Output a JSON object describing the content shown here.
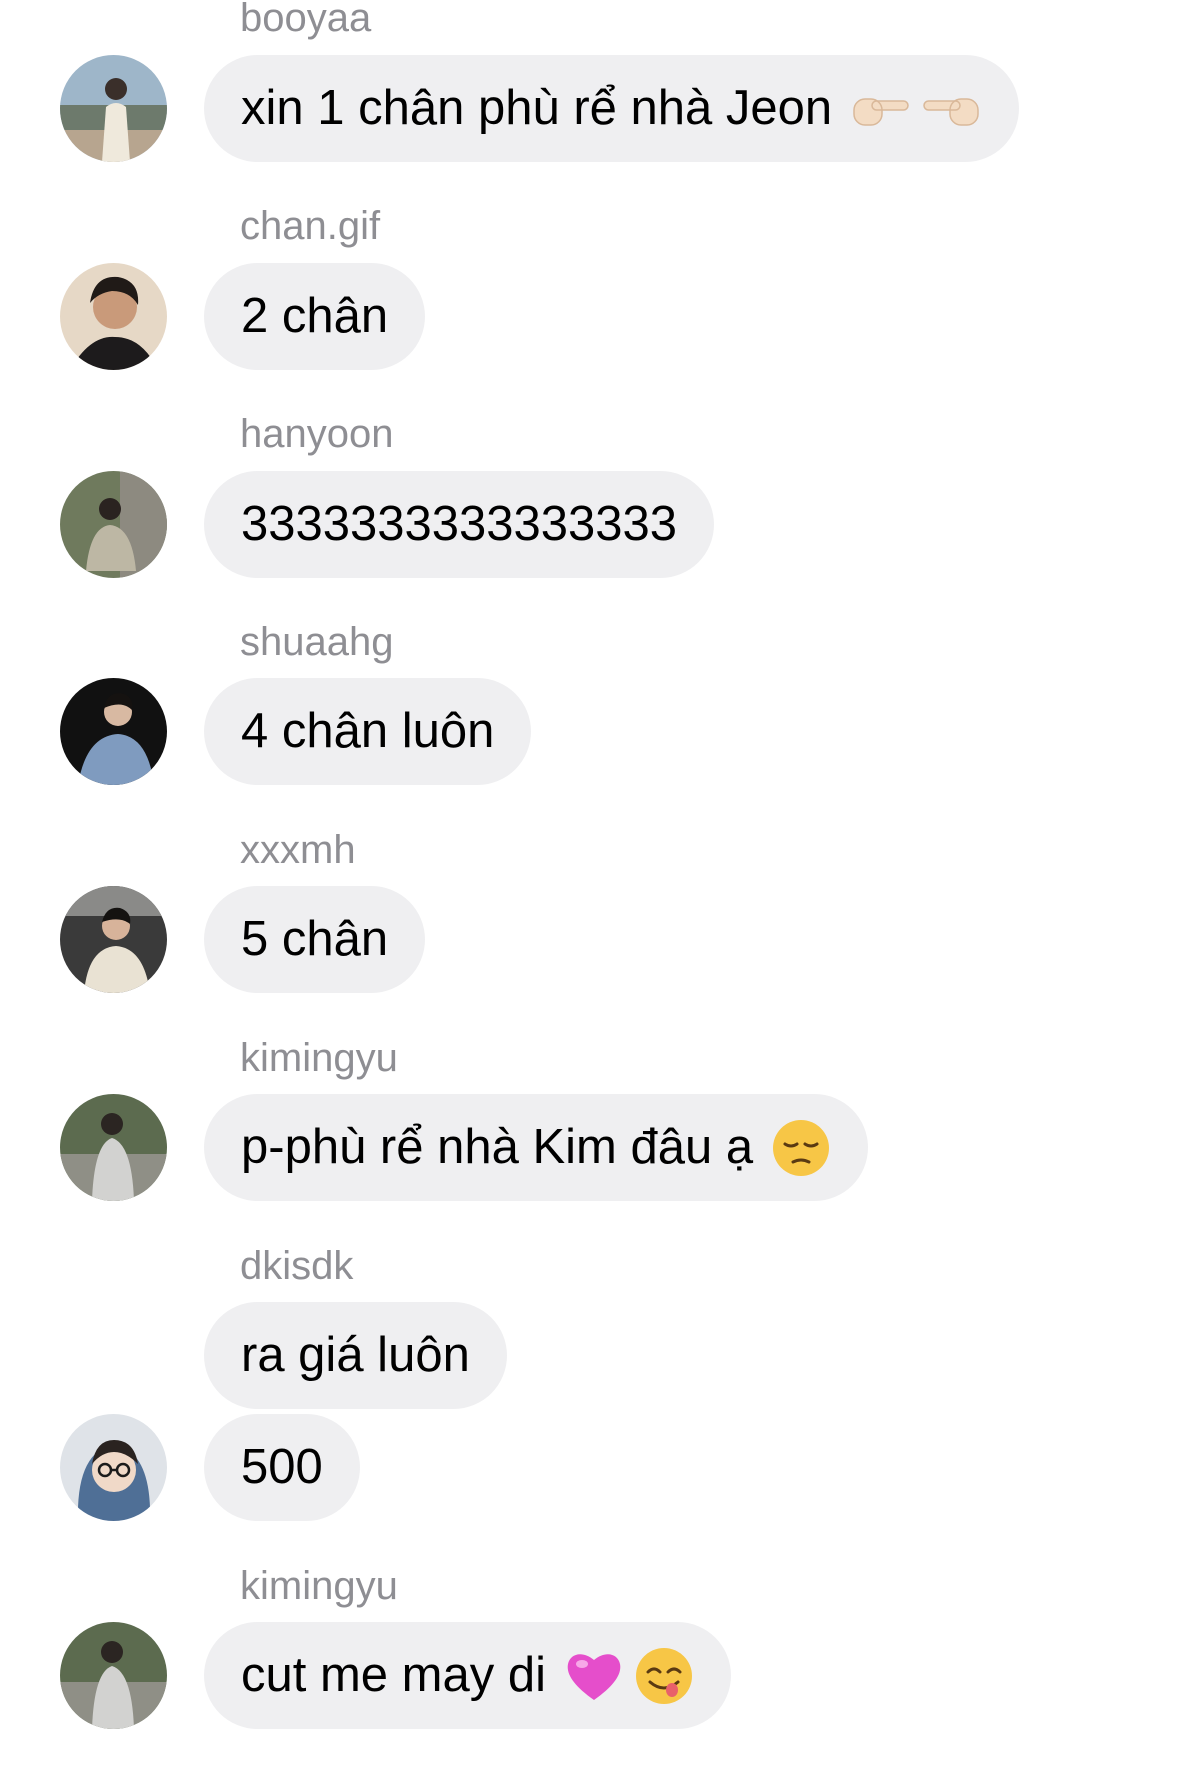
{
  "messages": [
    {
      "sender": "booyaa",
      "text": "xin 1 chân phù rể nhà Jeon",
      "emoji": [
        "backhand-index-pointing-right-emoji",
        "backhand-index-pointing-left-emoji"
      ]
    },
    {
      "sender": "chan.gif",
      "text": "2 chân",
      "emoji": []
    },
    {
      "sender": "hanyoon",
      "text": "3333333333333333",
      "emoji": []
    },
    {
      "sender": "shuaahg",
      "text": "4 chân luôn",
      "emoji": []
    },
    {
      "sender": "xxxmh",
      "text": "5 chân",
      "emoji": []
    },
    {
      "sender": "kimingyu",
      "text": "p-phù rể nhà Kim đâu ạ",
      "emoji": [
        "pensive-face-emoji"
      ]
    },
    {
      "sender": "dkisdk",
      "text": "ra giá luôn",
      "emoji": []
    },
    {
      "sender": "",
      "text": "500",
      "emoji": []
    },
    {
      "sender": "kimingyu",
      "text": "cut me may di",
      "emoji": [
        "pink-heart-emoji",
        "face-savoring-food-emoji"
      ]
    }
  ],
  "colors": {
    "background": "#ffffff",
    "bubble": "#efeff1",
    "sender_name": "#8e8e93",
    "text": "#000000"
  }
}
